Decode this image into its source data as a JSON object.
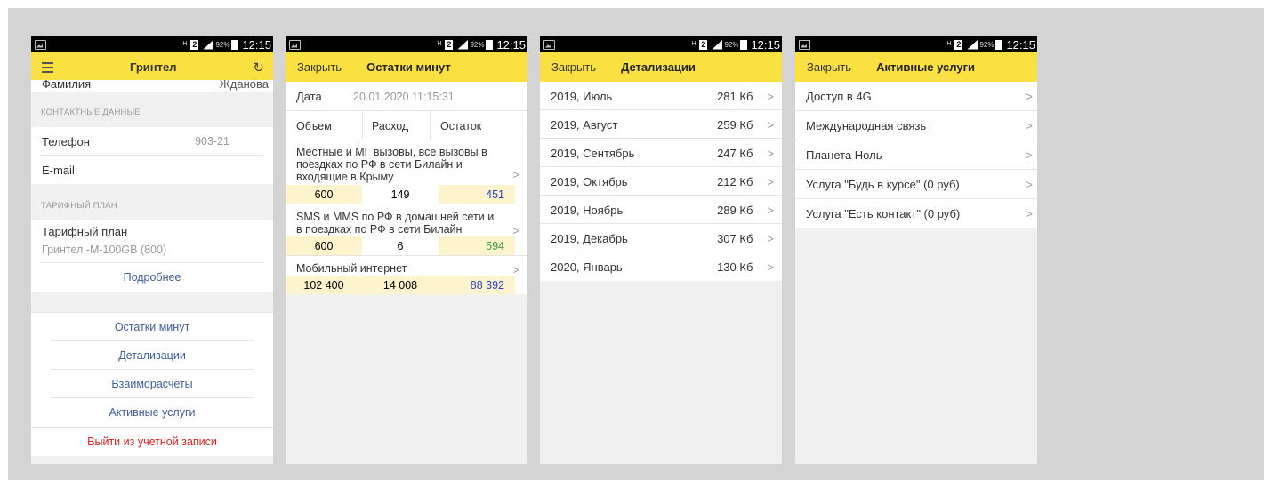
{
  "status_bar": {
    "h_plus": "H",
    "sim": "2",
    "battery_percent": "92%",
    "time": "12:15"
  },
  "screen1": {
    "title": "Гринтел",
    "surname_label": "Фамилия",
    "surname_value": "Жданова",
    "contacts_header": "КОНТАКТНЫЕ ДАННЫЕ",
    "phone_label": "Телефон",
    "phone_value": "903-21",
    "email_label": "E-mail",
    "tariff_header": "ТАРИФНЫЙ ПЛАН",
    "tariff_label": "Тарифный план",
    "tariff_value": "Гринтел -М-100GB (800)",
    "more_link": "Подробнее",
    "nav": [
      "Остатки минут",
      "Детализации",
      "Взаиморасчеты",
      "Активные услуги"
    ],
    "logout": "Выйти из учетной записи"
  },
  "screen2": {
    "close": "Закрыть",
    "title": "Остатки минут",
    "date_label": "Дата",
    "date_value": "20.01.2020 11:15:31",
    "col_headers": [
      "Объем",
      "Расход",
      "Остаток"
    ],
    "rows": [
      {
        "name": "Местные и МГ вызовы, все вызовы в поездках по РФ в сети Билайн и входящие в Крыму",
        "volume": "600",
        "spent": "149",
        "rest": "451"
      },
      {
        "name": "SMS и MMS по РФ в домашней сети и в поездках по РФ в сети Билайн",
        "volume": "600",
        "spent": "6",
        "rest": "594"
      },
      {
        "name": "Мобильный интернет",
        "volume": "102 400",
        "spent": "14 008",
        "rest": "88 392"
      }
    ]
  },
  "screen3": {
    "close": "Закрыть",
    "title": "Детализации",
    "items": [
      {
        "period": "2019, Июль",
        "size": "281 Кб"
      },
      {
        "period": "2019, Август",
        "size": "259 Кб"
      },
      {
        "period": "2019, Сентябрь",
        "size": "247 Кб"
      },
      {
        "period": "2019, Октябрь",
        "size": "212 Кб"
      },
      {
        "period": "2019, Ноябрь",
        "size": "289 Кб"
      },
      {
        "period": "2019, Декабрь",
        "size": "307 Кб"
      },
      {
        "period": "2020, Январь",
        "size": "130 Кб"
      }
    ]
  },
  "screen4": {
    "close": "Закрыть",
    "title": "Активные услуги",
    "items": [
      "Доступ в 4G",
      "Международная связь",
      "Планета Ноль",
      "Услуга \"Будь в курсе\" (0 руб)",
      "Услуга \"Есть контакт\" (0 руб)"
    ]
  },
  "colors": {
    "accent": "#FBE041",
    "link": "#3E5E9E",
    "danger": "#E02020",
    "rest_blue": "#2B3FBF",
    "rest_green": "#3D9A3D"
  }
}
